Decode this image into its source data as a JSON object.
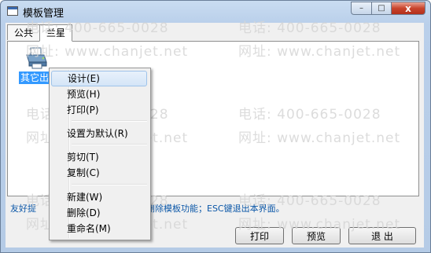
{
  "window": {
    "title": "模板管理",
    "controls": [
      "–",
      "□",
      "x"
    ]
  },
  "tabs": [
    "公共",
    "兰星"
  ],
  "active_tab": "兰星",
  "list": {
    "selected_item_label": "其它出"
  },
  "hint_text": "友好提示：右键单击模板可进行设计、删除模板功能；ESC键退出本界面。",
  "hint_visible_left": "友好提",
  "hint_visible_right": "计、删除模板功能；ESC键退出本界面。",
  "buttons": {
    "print": "打印",
    "preview": "预览",
    "exit": "退 出"
  },
  "context_menu": {
    "items": [
      {
        "label": "设计(E)",
        "highlighted": true
      },
      {
        "label": "预览(H)"
      },
      {
        "label": "打印(P)"
      },
      {
        "label": "设置为默认(R)"
      },
      {
        "label": "剪切(T)"
      },
      {
        "label": "复制(C)"
      },
      {
        "label": "新建(W)"
      },
      {
        "label": "删除(D)"
      },
      {
        "label": "重命名(M)"
      }
    ]
  },
  "watermark": {
    "phone": "电话: 400-665-0028",
    "site": "网址: www.chanjet.net"
  },
  "colors": {
    "selection": "#3399ff",
    "hint_text": "#0b57a8",
    "watermark": "#d6d6d6"
  }
}
